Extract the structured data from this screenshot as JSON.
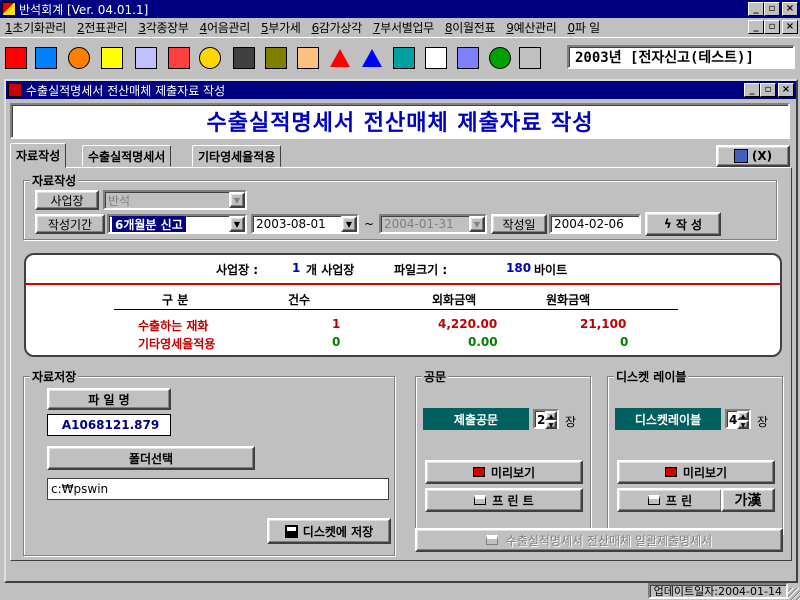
{
  "app": {
    "title": "반석회계 [Ver. 04.01.1]",
    "company": "2003년 [전자신고(테스트)]",
    "window_buttons": [
      "_",
      "▫",
      "×"
    ]
  },
  "menu": [
    {
      "key": "1",
      "label": "초기화관리"
    },
    {
      "key": "2",
      "label": "전표관리"
    },
    {
      "key": "3",
      "label": "각종장부"
    },
    {
      "key": "4",
      "label": "어음관리"
    },
    {
      "key": "5",
      "label": "부가세"
    },
    {
      "key": "6",
      "label": "감가상각"
    },
    {
      "key": "7",
      "label": "부서별업무"
    },
    {
      "key": "8",
      "label": "이월전표"
    },
    {
      "key": "9",
      "label": "예산관리"
    },
    {
      "key": "0",
      "label": "파 일"
    }
  ],
  "toolbar_icons": [
    {
      "name": "exit-icon",
      "color": "#ff0000"
    },
    {
      "name": "org-chart-icon",
      "color": "#0080ff"
    },
    {
      "name": "globe-icon",
      "color": "#ff8000"
    },
    {
      "name": "pencil-icon",
      "color": "#ffff00"
    },
    {
      "name": "key-icon",
      "color": "#c0c0ff"
    },
    {
      "name": "calculator-icon",
      "color": "#ff4040"
    },
    {
      "name": "coin-icon",
      "color": "#ffd700"
    },
    {
      "name": "books-icon",
      "color": "#404040"
    },
    {
      "name": "scale-icon",
      "color": "#808000"
    },
    {
      "name": "hand-icon",
      "color": "#ffc080"
    },
    {
      "name": "arrow-up-red-icon",
      "color": "#ff0000"
    },
    {
      "name": "arrow-up-blue-icon",
      "color": "#0000ff"
    },
    {
      "name": "sort-icon",
      "color": "#00a0a0"
    },
    {
      "name": "table-icon",
      "color": "#ffffff"
    },
    {
      "name": "printer-icon",
      "color": "#8080ff"
    },
    {
      "name": "refresh-icon",
      "color": "#00a000"
    },
    {
      "name": "window-icon",
      "color": "#c0c0c0"
    }
  ],
  "child": {
    "title": "수출실적명세서 전산매체 제출자료 작성",
    "banner": "수출실적명세서 전산매체 제출자료 작성",
    "tabs": [
      "자료작성",
      "수출실적명세서",
      "기타영세율적용"
    ],
    "close_label": "(X)"
  },
  "form": {
    "group_title": "자료작성",
    "site_label": "사업장",
    "site_value": "반석",
    "period_label": "작성기간",
    "period_value": "6개월분 신고",
    "date_from": "2003-08-01",
    "tilde": "~",
    "date_to": "2004-01-31",
    "written_label": "작성일",
    "written_value": "2004-02-06",
    "create_label": "작 성"
  },
  "summary": {
    "site_label": "사업장 :",
    "site_count": "1",
    "site_unit": "개 사업장",
    "size_label": "파일크기 :",
    "size_value": "180",
    "size_unit": "바이트",
    "headers": [
      "구    분",
      "건수",
      "외화금액",
      "원화금액"
    ],
    "rows": [
      {
        "label": "수출하는 재화",
        "count": "1",
        "foreign": "4,220.00",
        "won": "21,100"
      },
      {
        "label": "기타영세율적용",
        "count": "0",
        "foreign": "0.00",
        "won": "0"
      }
    ],
    "colors": {
      "row1": "#c00000",
      "row2": "#008000",
      "count": "#0000c0"
    }
  },
  "save": {
    "group_title": "자료저장",
    "filename_label": "파 일 명",
    "filename_value": "A1068121.879",
    "folder_label": "폴더선택",
    "folder_value": "c:₩pswin",
    "save_label": "디스켓에 저장"
  },
  "letter": {
    "group_title": "공문",
    "teal_label": "제출공문",
    "count": "2",
    "unit": "장",
    "preview_label": "미리보기",
    "print_label": "프 린 트"
  },
  "diskette": {
    "group_title": "디스켓 레이블",
    "teal_label": "디스켓레이블",
    "count": "4",
    "unit": "장",
    "preview_label": "미리보기",
    "print_label": "프 린",
    "ime_label": "가漢"
  },
  "bottom_button": "수출실적명세서 전산매체 일괄제출명세서",
  "status": "업데이트일자:2004-01-14"
}
